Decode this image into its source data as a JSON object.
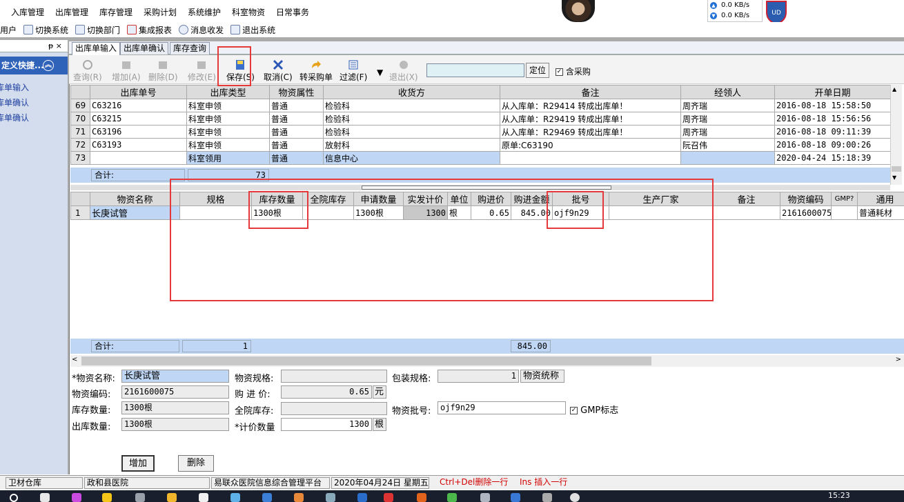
{
  "menu": [
    "入库管理",
    "出库管理",
    "库存管理",
    "采购计划",
    "系统维护",
    "科室物资",
    "日常事务"
  ],
  "net": {
    "up": "0.0 KB/s",
    "down": "0.0 KB/s"
  },
  "toolbar1": [
    "用户",
    "切换系统",
    "切换部门",
    "集成报表",
    "消息收发",
    "退出系统"
  ],
  "left_panel": {
    "pin": "ᵽ ×",
    "title": "定义快捷...",
    "items": [
      "出库单输入",
      "出库单确认",
      "入库单确认"
    ]
  },
  "tabs": [
    "出库单输入",
    "出库单确认",
    "库存查询"
  ],
  "toolbar2": {
    "buttons": [
      "查询(R)",
      "增加(A)",
      "删除(D)",
      "修改(E)",
      "保存(S)",
      "取消(C)",
      "转采购单",
      "过滤(F)",
      "退出(X)"
    ],
    "locate": "定位",
    "include_purchase": "含采购"
  },
  "grid1": {
    "headers": [
      "出库单号",
      "出库类型",
      "物资属性",
      "收货方",
      "备注",
      "经领人",
      "开单日期"
    ],
    "rows": [
      {
        "n": "69",
        "no": "C63216",
        "type": "科室申领",
        "attr": "普通",
        "to": "检验科",
        "note": "从入库单：R29414 转成出库单！",
        "person": "周齐瑞",
        "date": "2016-08-18 15:58:50"
      },
      {
        "n": "70",
        "no": "C63215",
        "type": "科室申领",
        "attr": "普通",
        "to": "检验科",
        "note": "从入库单：R29419 转成出库单！",
        "person": "周齐瑞",
        "date": "2016-08-18 15:56:56"
      },
      {
        "n": "71",
        "no": "C63196",
        "type": "科室申领",
        "attr": "普通",
        "to": "检验科",
        "note": "从入库单：R29469 转成出库单！",
        "person": "周齐瑞",
        "date": "2016-08-18 09:11:39"
      },
      {
        "n": "72",
        "no": "C63193",
        "type": "科室申领",
        "attr": "普通",
        "to": "放射科",
        "note": "原单:C63190",
        "person": "阮召伟",
        "date": "2016-08-18 09:00:26"
      },
      {
        "n": "73",
        "no": "",
        "type": "科室领用",
        "attr": "普通",
        "to": "信息中心",
        "note": "",
        "person": "",
        "date": "2020-04-24 15:18:39"
      }
    ],
    "sum_label": "合计:",
    "sum_value": "73"
  },
  "grid2": {
    "headers": [
      "物资名称",
      "规格",
      "库存数量",
      "全院库存",
      "申请数量",
      "实发计价",
      "单位",
      "购进价",
      "购进金额",
      "批号",
      "生产厂家",
      "备注",
      "物资编码",
      "GMP?",
      "通用"
    ],
    "rows": [
      {
        "n": "1",
        "name": "长庚试管",
        "spec": "",
        "stock": "1300根",
        "all": "",
        "apply": "1300根",
        "actual": "1300",
        "unit": "根",
        "price": "0.65",
        "amount": "845.00",
        "batch": "ojf9n29",
        "maker": "",
        "note": "",
        "code": "2161600075",
        "gmp": "",
        "general": "普通耗材"
      }
    ],
    "sum_label": "合计:",
    "sum_count": "1",
    "sum_amount": "845.00"
  },
  "form": {
    "name_label": "*物资名称:",
    "name": "长庚试管",
    "spec_label": "物资规格:",
    "spec": "",
    "pack_label": "包装规格:",
    "pack": "1",
    "pack_unit": "物资统称",
    "code_label": "物资编码:",
    "code": "2161600075",
    "price_label": "购 进 价:",
    "price": "0.65",
    "price_unit": "元",
    "stock_label": "库存数量:",
    "stock": "1300根",
    "all_label": "全院库存:",
    "all": "",
    "batch_label": "物资批号:",
    "batch": "ojf9n29",
    "gmp": "GMP标志",
    "out_label": "出库数量:",
    "out": "1300根",
    "count_label": "*计价数量",
    "count": "1300",
    "count_unit": "根",
    "add": "增加",
    "delete": "删除"
  },
  "status": [
    "卫材仓库",
    "政和县医院",
    "易联众医院信息综合管理平台",
    "2020年04月24日 星期五",
    "Ctrl+Del删除一行",
    "Ins 插入一行"
  ],
  "taskbar_time": "15:23"
}
